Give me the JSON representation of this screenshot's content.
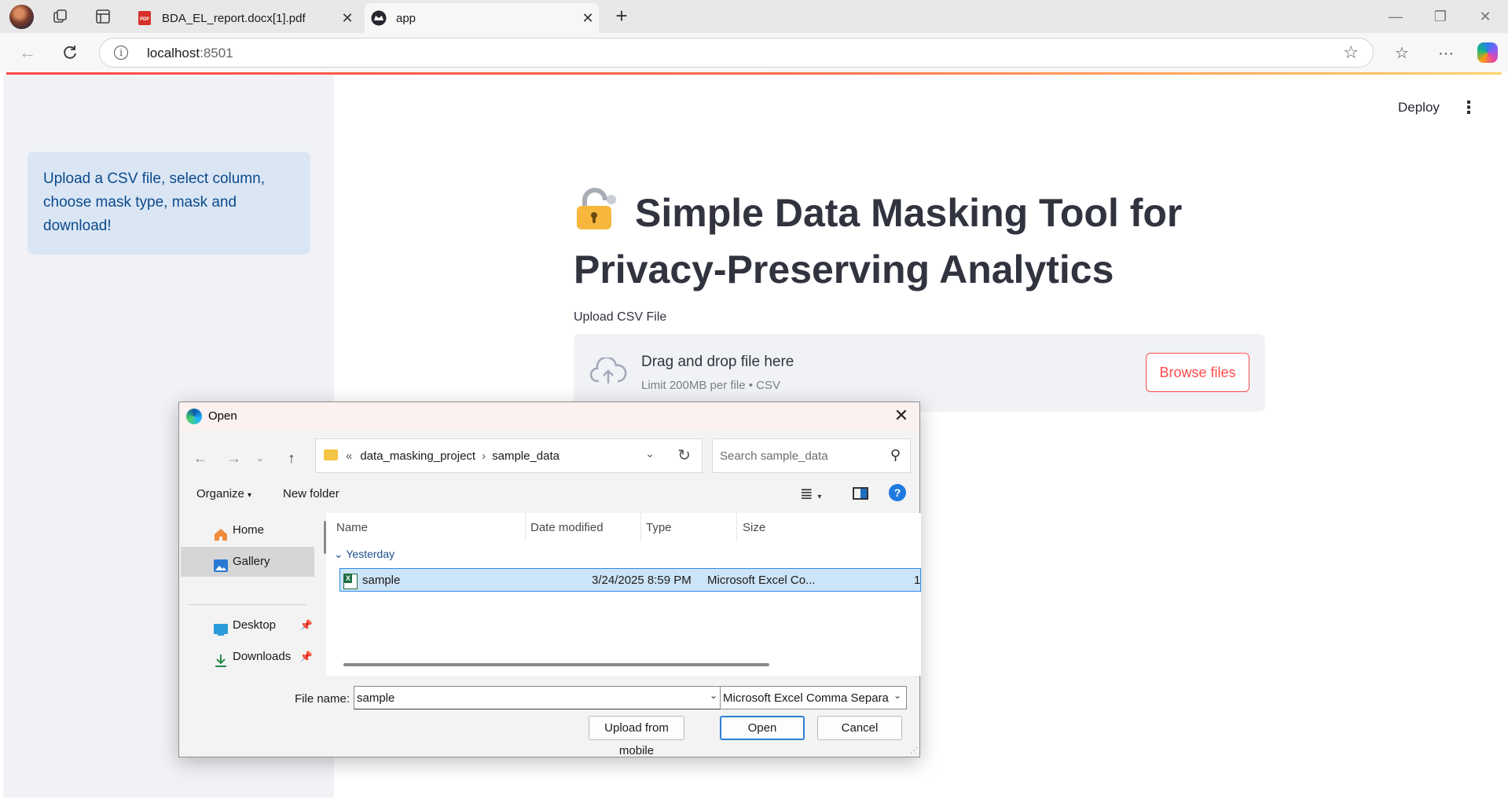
{
  "browser": {
    "tabs": [
      {
        "title": "BDA_EL_report.docx[1].pdf",
        "icon": "pdf-icon"
      },
      {
        "title": "app",
        "icon": "streamlit-icon"
      }
    ],
    "url_host": "localhost",
    "url_port": ":8501"
  },
  "sidebar": {
    "info_text": "Upload a CSV file, select column, choose mask type, mask and download!"
  },
  "header": {
    "deploy_label": "Deploy"
  },
  "main": {
    "title": "Simple Data Masking Tool for Privacy-Preserving Analytics",
    "uploader": {
      "label": "Upload CSV File",
      "drop_text": "Drag and drop file here",
      "limit_text": "Limit 200MB per file • CSV",
      "browse_label": "Browse files"
    }
  },
  "dialog": {
    "title": "Open",
    "path": [
      "data_masking_project",
      "sample_data"
    ],
    "path_prefix": "«",
    "search_placeholder": "Search sample_data",
    "organize_label": "Organize",
    "new_folder_label": "New folder",
    "nav_items": [
      {
        "label": "Home",
        "icon": "home-icon"
      },
      {
        "label": "Gallery",
        "icon": "gallery-icon"
      },
      {
        "label": "Desktop",
        "icon": "desktop-icon"
      },
      {
        "label": "Downloads",
        "icon": "downloads-icon"
      }
    ],
    "columns": [
      "Name",
      "Date modified",
      "Type",
      "Size"
    ],
    "group": "Yesterday",
    "files": [
      {
        "name": "sample",
        "date": "3/24/2025 8:59 PM",
        "type": "Microsoft Excel Co...",
        "size": "1"
      }
    ],
    "file_name_label": "File name:",
    "file_name_value": "sample",
    "file_type_value": "Microsoft Excel Comma Separa",
    "upload_mobile_label": "Upload from mobile",
    "open_label": "Open",
    "cancel_label": "Cancel"
  },
  "colors": {
    "accent": "#ff4b4b",
    "info_bg": "#dbe6f5",
    "info_text": "#0b4a8b",
    "sidebar_bg": "#f0f2f6"
  }
}
